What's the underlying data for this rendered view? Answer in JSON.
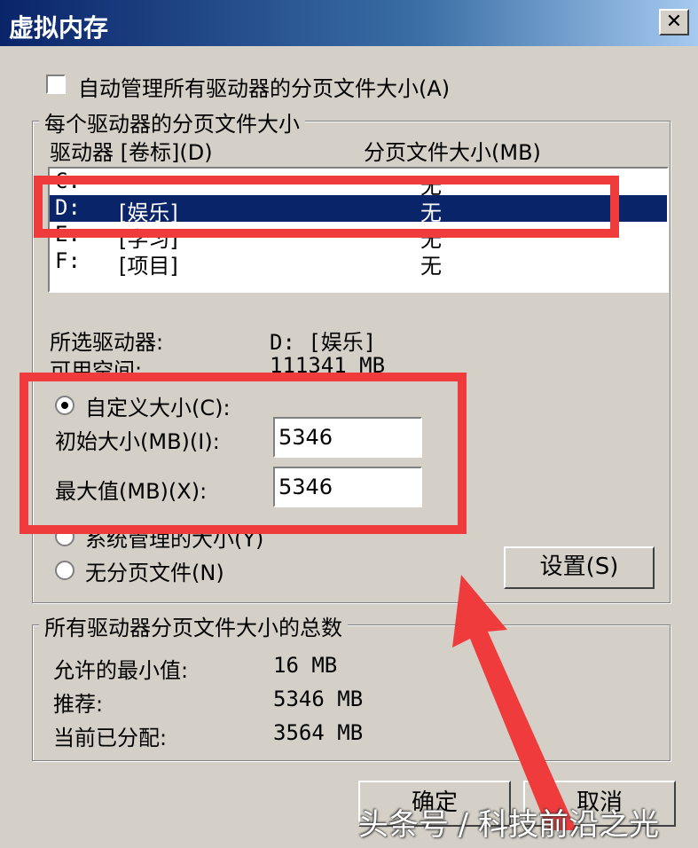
{
  "window": {
    "title": "虚拟内存",
    "close_glyph": "✕"
  },
  "auto_manage": {
    "label": "自动管理所有驱动器的分页文件大小(A)"
  },
  "per_drive": {
    "group_label": "每个驱动器的分页文件大小",
    "col_drive": "驱动器 [卷标](D)",
    "col_size": "分页文件大小(MB)",
    "rows": [
      {
        "drive": "C:",
        "label": "",
        "size": "无"
      },
      {
        "drive": "D:",
        "label": "[娱乐]",
        "size": "无"
      },
      {
        "drive": "E:",
        "label": "[学习]",
        "size": "无"
      },
      {
        "drive": "F:",
        "label": "[项目]",
        "size": "无"
      }
    ],
    "selected_label": "所选驱动器:",
    "selected_value": "D:  [娱乐]",
    "free_label": "可用空间:",
    "free_value": "111341 MB"
  },
  "custom": {
    "label": "自定义大小(C):",
    "initial_label": "初始大小(MB)(I):",
    "initial_value": "5346",
    "max_label": "最大值(MB)(X):",
    "max_value": "5346"
  },
  "system_managed": {
    "label": "系统管理的大小(Y)"
  },
  "no_paging": {
    "label": "无分页文件(N)"
  },
  "set_button": "设置(S)",
  "totals": {
    "group_label": "所有驱动器分页文件大小的总数",
    "min_label": "允许的最小值:",
    "min_value": "16 MB",
    "rec_label": "推荐:",
    "rec_value": "5346 MB",
    "cur_label": "当前已分配:",
    "cur_value": "3564 MB"
  },
  "buttons": {
    "ok": "确定",
    "cancel": "取消"
  },
  "watermark": "头条号 / 科技前沿之光",
  "colors": {
    "highlight": "#ef3b3b",
    "selection": "#0a246a",
    "face": "#d4d0c8"
  }
}
